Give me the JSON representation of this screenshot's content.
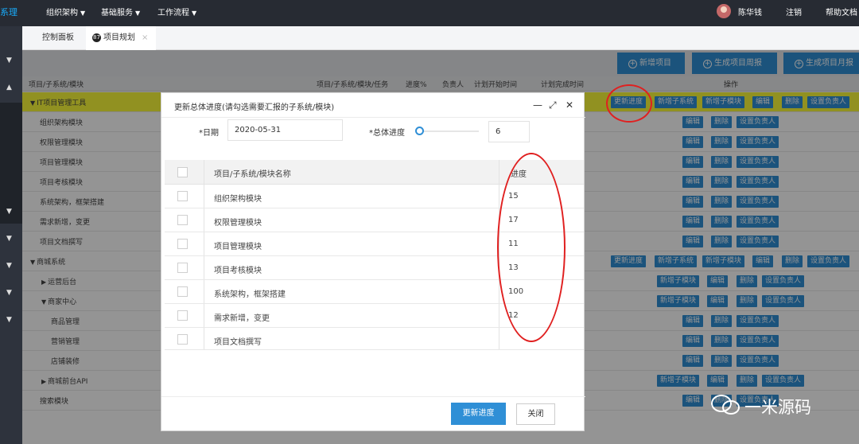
{
  "topbar": {
    "brand": "系理",
    "nav": [
      {
        "label": "组织架构"
      },
      {
        "label": "基础服务"
      },
      {
        "label": "工作流程"
      }
    ],
    "user_name": "陈华钱",
    "logout": "注销",
    "help": "帮助文档"
  },
  "tabs": [
    {
      "label": "控制面板"
    },
    {
      "label": "项目规划",
      "icon_text": "87"
    }
  ],
  "toolbar": {
    "add_project": "新增项目",
    "gen_weekly": "生成项目周报",
    "gen_monthly": "生成项目月报"
  },
  "table": {
    "headers": [
      "项目/子系统/模块",
      "项目/子系统/模块/任务",
      "进度%",
      "负责人",
      "计划开始时间",
      "计划完成时间",
      "操作"
    ],
    "rows": [
      {
        "name": "IT项目管理工具",
        "actions": [
          "更新进度",
          "新增子系统",
          "新增子模块",
          "编辑",
          "删除",
          "设置负责人"
        ]
      },
      {
        "name": "组织架构模块",
        "actions": [
          "编辑",
          "删除",
          "设置负责人"
        ]
      },
      {
        "name": "权限管理模块",
        "actions": [
          "编辑",
          "删除",
          "设置负责人"
        ]
      },
      {
        "name": "项目管理模块",
        "actions": [
          "编辑",
          "删除",
          "设置负责人"
        ]
      },
      {
        "name": "项目考核模块",
        "actions": [
          "编辑",
          "删除",
          "设置负责人"
        ]
      },
      {
        "name": "系统架构，框架搭建",
        "actions": [
          "编辑",
          "删除",
          "设置负责人"
        ]
      },
      {
        "name": "需求新增，变更",
        "actions": [
          "编辑",
          "删除",
          "设置负责人"
        ]
      },
      {
        "name": "项目文档撰写",
        "actions": [
          "编辑",
          "删除",
          "设置负责人"
        ]
      },
      {
        "name": "商城系统",
        "actions": [
          "更新进度",
          "新增子系统",
          "新增子模块",
          "编辑",
          "删除",
          "设置负责人"
        ]
      },
      {
        "name": "运营后台",
        "actions": [
          "新增子模块",
          "编辑",
          "删除",
          "设置负责人"
        ]
      },
      {
        "name": "商家中心",
        "actions": [
          "新增子模块",
          "编辑",
          "删除",
          "设置负责人"
        ]
      },
      {
        "name": "商品管理",
        "actions": [
          "编辑",
          "删除",
          "设置负责人"
        ]
      },
      {
        "name": "营销管理",
        "actions": [
          "编辑",
          "删除",
          "设置负责人"
        ]
      },
      {
        "name": "店铺装修",
        "actions": [
          "编辑",
          "删除",
          "设置负责人"
        ]
      },
      {
        "name": "商城前台API",
        "actions": [
          "新增子模块",
          "编辑",
          "删除",
          "设置负责人"
        ]
      },
      {
        "name": "搜索模块",
        "actions": [
          "编辑",
          "删除",
          "设置负责人"
        ]
      }
    ]
  },
  "modal": {
    "title": "更新总体进度(请勾选需要汇报的子系统/模块)",
    "date_label": "*日期",
    "date_value": "2020-05-31",
    "progress_label": "*总体进度",
    "progress_value": "6",
    "col_name": "项目/子系统/模块名称",
    "col_progress": "进度",
    "rows": [
      {
        "name": "组织架构模块",
        "progress": "15"
      },
      {
        "name": "权限管理模块",
        "progress": "17"
      },
      {
        "name": "项目管理模块",
        "progress": "11"
      },
      {
        "name": "项目考核模块",
        "progress": "13"
      },
      {
        "name": "系统架构，框架搭建",
        "progress": "100"
      },
      {
        "name": "需求新增，变更",
        "progress": "12"
      },
      {
        "name": "项目文档撰写",
        "progress": ""
      }
    ],
    "submit": "更新进度",
    "close": "关闭"
  },
  "watermark": "一米源码",
  "colors": {
    "primary": "#2f8fd6",
    "highlight_row": "#fafa3a",
    "annotation_red": "#e02020",
    "topbar": "#272b33"
  }
}
